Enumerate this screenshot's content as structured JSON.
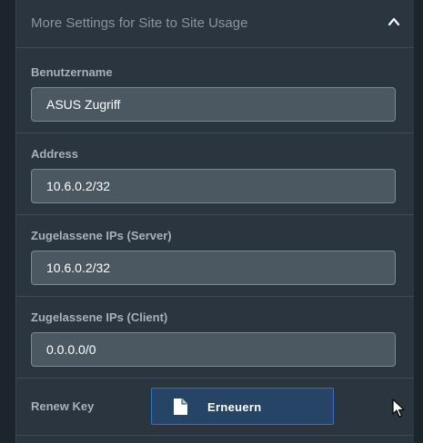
{
  "header": {
    "title": "More Settings for Site to Site Usage",
    "toggle_icon": "chevron-up-icon"
  },
  "fields": [
    {
      "label": "Benutzername",
      "value": "ASUS Zugriff"
    },
    {
      "label": "Address",
      "value": "10.6.0.2/32"
    },
    {
      "label": "Zugelassene IPs (Server)",
      "value": "10.6.0.2/32"
    },
    {
      "label": "Zugelassene IPs (Client)",
      "value": "0.0.0.0/0"
    }
  ],
  "renew": {
    "label": "Renew Key",
    "button_label": "Erneuern",
    "button_icon": "document-icon"
  },
  "colors": {
    "panel_bg": "#2a3540",
    "input_bg": "#4c5861",
    "button_bg": "#264566",
    "button_border": "#2e73c0"
  }
}
